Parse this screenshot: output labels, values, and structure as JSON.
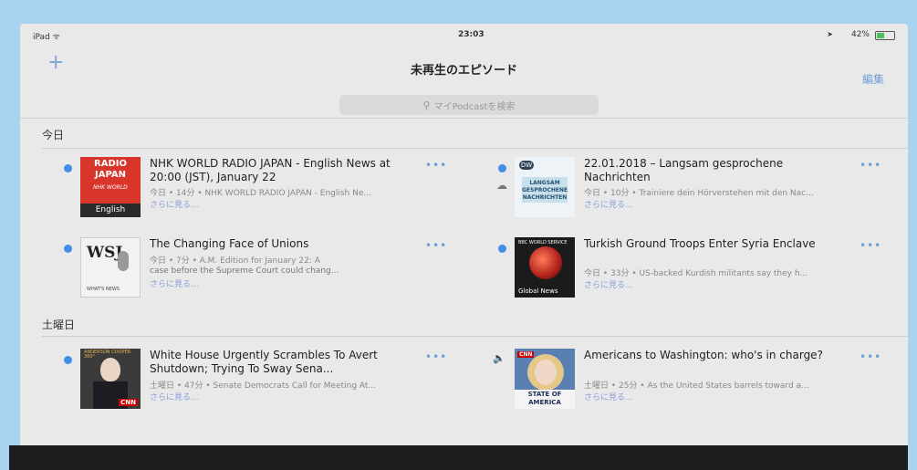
{
  "status_bar": {
    "carrier": "iPad ᯤ",
    "time": "23:03",
    "battery_text": "42%",
    "battery_level": 0.42
  },
  "nav": {
    "add_label": "+",
    "title": "未再生のエピソード",
    "edit_label": "編集"
  },
  "search": {
    "placeholder": "マイPodcastを検索"
  },
  "sections": [
    {
      "title": "今日"
    },
    {
      "title": "土曜日"
    }
  ],
  "episodes": [
    {
      "art_lines": [
        "RADIO",
        "JAPAN"
      ],
      "art_sub": "NHK WORLD",
      "art_badge": "English",
      "title": "NHK WORLD RADIO JAPAN - English News at 20:00 (JST), January 22",
      "meta": "今日 • 14分 • NHK WORLD RADIO JAPAN - English Ne...",
      "more": "さらに見る..."
    },
    {
      "art_logo": "DW",
      "art_box": [
        "LANGSAM",
        "GESPROCHENE",
        "NACHRICHTEN"
      ],
      "title": "22.01.2018 – Langsam gesprochene Nachrichten",
      "meta": "今日 • 10分 • Trainiere dein Hörverstehen mit den Nac...",
      "more": "さらに見る..."
    },
    {
      "art_text": "WSJ",
      "art_foot": "WHAT'S NEWS",
      "title": "The Changing Face of Unions",
      "meta": "今日 • 7分 • A.M. Edition for January 22: A",
      "desc": "case before the Supreme Court could chang...",
      "more": "さらに見る..."
    },
    {
      "art_hdr": "BBC WORLD SERVICE",
      "art_foot": "Global News",
      "title": "Turkish Ground Troops Enter Syria Enclave",
      "meta": "今日 • 33分 • US-backed Kurdish militants say they h...",
      "more": "さらに見る..."
    },
    {
      "art_hdr": "ANDERSON COOPER 360°",
      "art_badge": "CNN",
      "title": "White House Urgently Scrambles To Avert Shutdown; Trying To Sway Sena...",
      "meta": "土曜日 • 47分 • Senate Democrats Call for Meeting At...",
      "more": "さらに見る..."
    },
    {
      "art_badge": "CNN",
      "art_band": [
        "STATE OF",
        "AMERICA"
      ],
      "title": "Americans to Washington: who's in charge?",
      "meta": "土曜日 • 25分 • As the United States barrels toward a...",
      "more": "さらに見る..."
    }
  ],
  "menu_label": "•••",
  "colors": {
    "accent": "#3f8fe6",
    "link": "#6e9fd6",
    "background": "#e9e9ea"
  }
}
